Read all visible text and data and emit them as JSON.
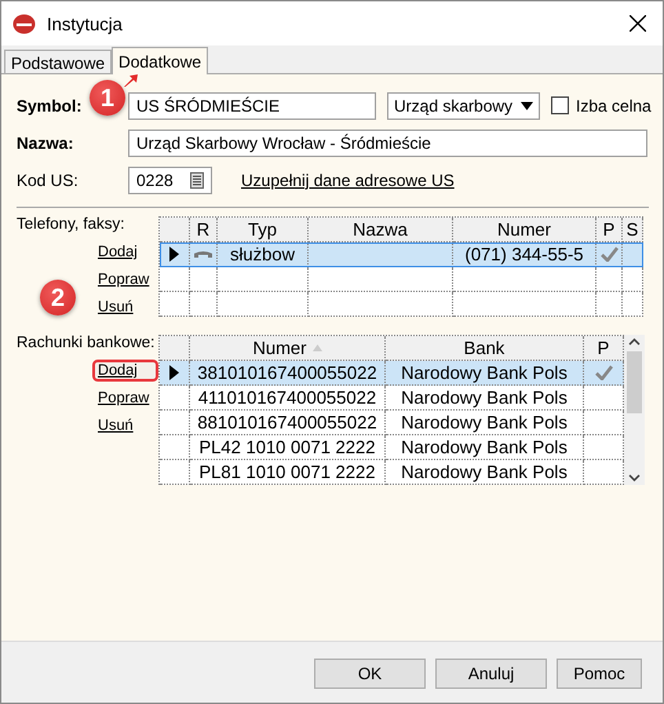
{
  "window": {
    "title": "Instytucja"
  },
  "tabs": [
    {
      "label": "Podstawowe",
      "selected": false
    },
    {
      "label": "Dodatkowe",
      "selected": true
    }
  ],
  "form": {
    "symbol": {
      "label": "Symbol:",
      "value": "US ŚRÓDMIEŚCIE"
    },
    "type_select": {
      "value": "Urząd skarbowy"
    },
    "customs_checkbox": {
      "label": "Izba celna",
      "checked": false
    },
    "name": {
      "label": "Nazwa:",
      "value": "Urząd Skarbowy Wrocław - Śródmieście"
    },
    "us_code": {
      "label": "Kod US:",
      "value": "0228"
    },
    "address_link": "Uzupełnij dane adresowe US"
  },
  "phones": {
    "label": "Telefony, faksy:",
    "actions": [
      {
        "label": "Dodaj",
        "highlighted": false
      },
      {
        "label": "Popraw",
        "highlighted": false
      },
      {
        "label": "Usuń",
        "highlighted": false
      }
    ],
    "columns": [
      "R",
      "Typ",
      "Nazwa",
      "Numer",
      "P",
      "S"
    ],
    "rows": [
      {
        "selected": true,
        "type": "służbow",
        "name_value": "",
        "number": "(071) 344-55-5",
        "primary": true
      }
    ]
  },
  "accounts": {
    "label": "Rachunki bankowe:",
    "actions": [
      {
        "label": "Dodaj",
        "highlighted": true
      },
      {
        "label": "Popraw",
        "highlighted": false
      },
      {
        "label": "Usuń",
        "highlighted": false
      }
    ],
    "columns": [
      "Numer",
      "Bank",
      "P"
    ],
    "rows": [
      {
        "selected": true,
        "number": "381010167400055022",
        "bank": "Narodowy Bank Pols",
        "primary": true
      },
      {
        "selected": false,
        "number": "411010167400055022",
        "bank": "Narodowy Bank Pols",
        "primary": false
      },
      {
        "selected": false,
        "number": "881010167400055022",
        "bank": "Narodowy Bank Pols",
        "primary": false
      },
      {
        "selected": false,
        "number": "PL42 1010 0071 2222",
        "bank": "Narodowy Bank Pols",
        "primary": false
      },
      {
        "selected": false,
        "number": "PL81 1010 0071 2222",
        "bank": "Narodowy Bank Pols",
        "primary": false
      }
    ]
  },
  "buttons": [
    "OK",
    "Anuluj",
    "Pomoc"
  ],
  "annotations": [
    {
      "text": "1"
    },
    {
      "text": "2"
    }
  ]
}
